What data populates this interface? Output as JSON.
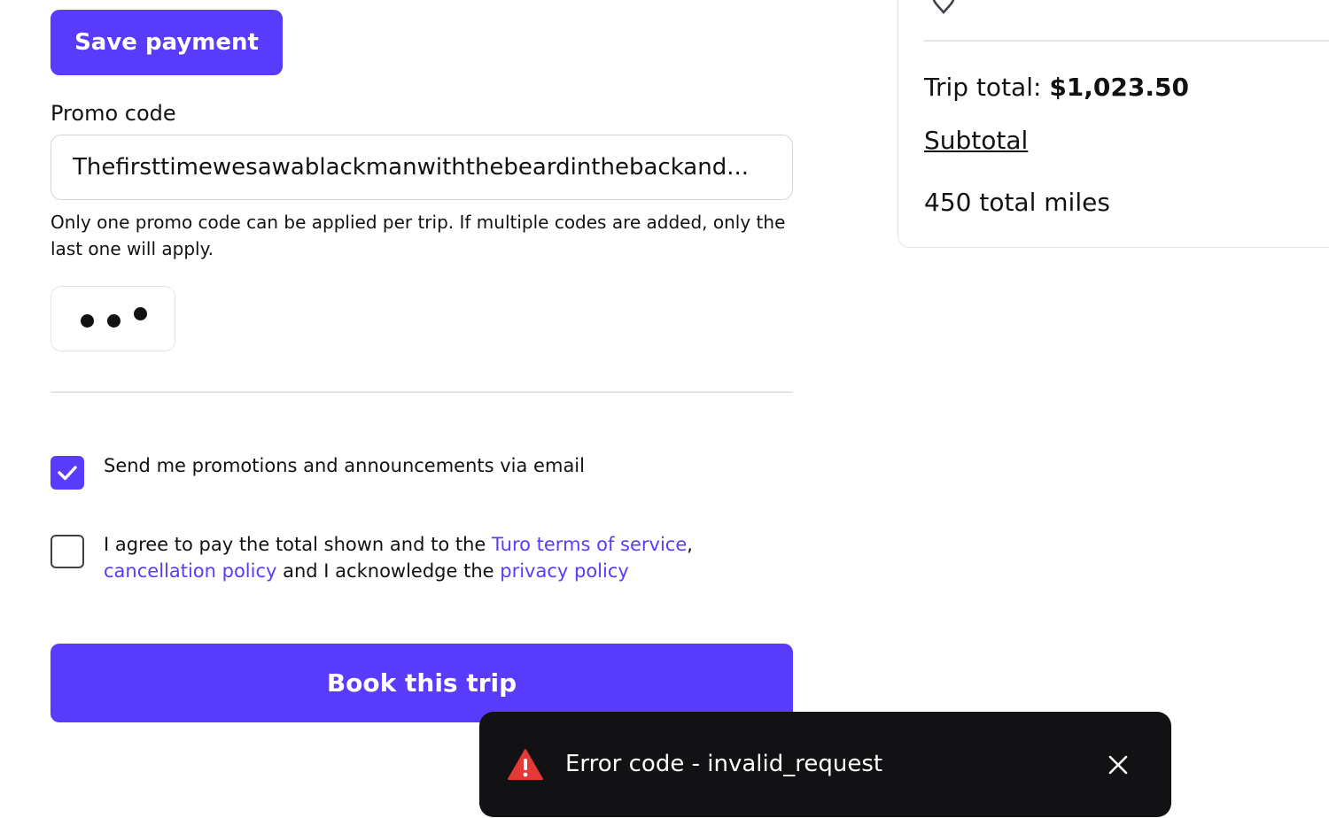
{
  "payment": {
    "save_label": "Save payment"
  },
  "promo": {
    "label": "Promo code",
    "value": "Thefirsttimewesawablackmanwiththebeardinthebackand...",
    "help": "Only one promo code can be applied per trip. If multiple codes are added, only the last one will apply."
  },
  "consent": {
    "promos_checked": true,
    "promos_label": "Send me promotions and announcements via email",
    "agree_checked": false,
    "agree_prefix": "I agree to pay the total shown and to the ",
    "terms_link": "Turo terms of service",
    "comma": ",",
    "cancellation_link": "cancellation policy",
    "agree_middle": " and I acknowledge the ",
    "privacy_link": "privacy policy"
  },
  "book": {
    "label": "Book this trip"
  },
  "summary": {
    "location_partial": "",
    "trip_total_label": "Trip total: ",
    "trip_total_value": "$1,023.50",
    "subtotal_label": "Subtotal",
    "miles": "450 total miles"
  },
  "toast": {
    "message": "Error code - invalid_request",
    "icon": "warning-icon",
    "icon_color": "#e53935"
  },
  "colors": {
    "accent": "#593cfb",
    "text": "#121214",
    "toast_bg": "#121214"
  }
}
